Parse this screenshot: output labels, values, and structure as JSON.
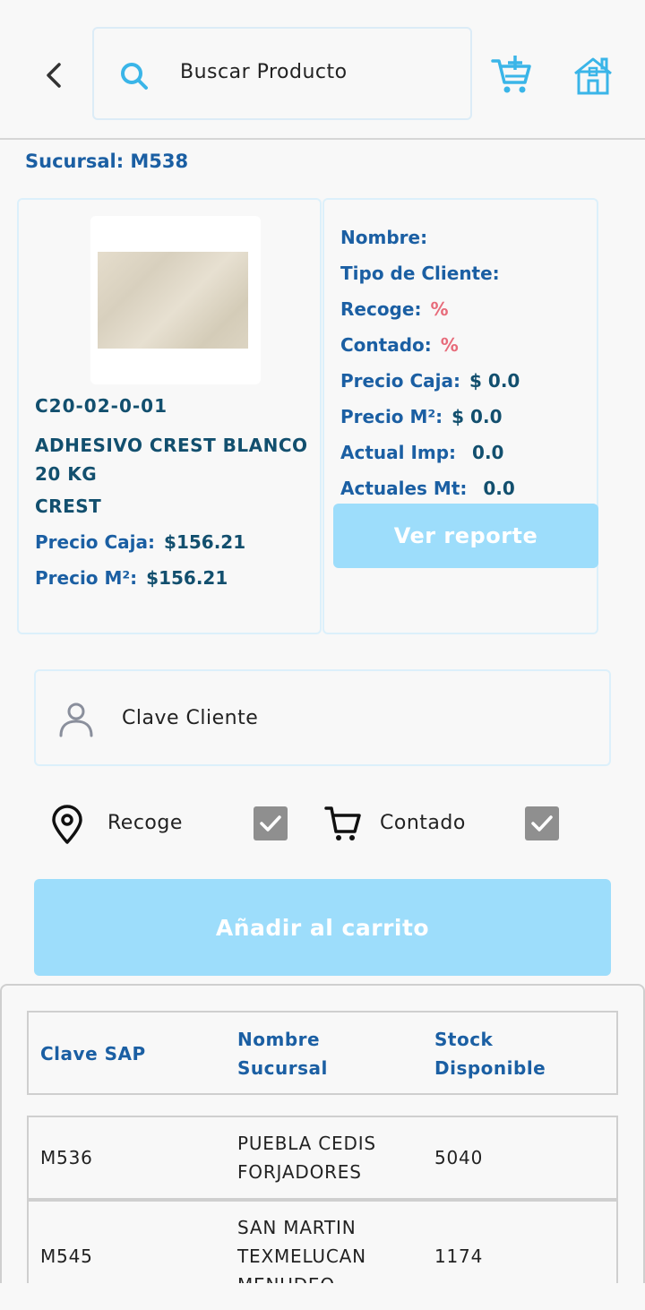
{
  "header": {
    "search_placeholder": "Buscar Producto"
  },
  "branch": "Sucursal: M538",
  "product": {
    "code": "C20-02-0-01",
    "name": "ADHESIVO CREST BLANCO 20 KG",
    "brand": "CREST",
    "price_box_label": "Precio Caja:",
    "price_box_value": "$156.21",
    "price_m2_label": "Precio M²:",
    "price_m2_value": "$156.21"
  },
  "info": {
    "name_label": "Nombre:",
    "client_type_label": "Tipo de Cliente:",
    "recoge_label": "Recoge:",
    "recoge_value": "%",
    "contado_label": "Contado:",
    "contado_value": "%",
    "price_box_label": "Precio Caja:",
    "price_box_value": "$ 0.0",
    "price_m2_label": "Precio M²:",
    "price_m2_value": "$ 0.0",
    "actual_imp_label": "Actual Imp:",
    "actual_imp_value": "0.0",
    "actual_mt_label": "Actuales Mt:",
    "actual_mt_value": "0.0",
    "report_button": "Ver reporte"
  },
  "client": {
    "placeholder": "Clave Cliente"
  },
  "options": {
    "recoge_label": "Recoge",
    "recoge_checked": true,
    "contado_label": "Contado",
    "contado_checked": true
  },
  "add_to_cart": "Añadir al carrito",
  "stock_table": {
    "headers": [
      "Clave SAP",
      "Nombre Sucursal",
      "Stock Disponible"
    ],
    "rows": [
      {
        "clave": "M536",
        "nombre": "PUEBLA CEDIS FORJADORES",
        "stock": "5040"
      },
      {
        "clave": "M545",
        "nombre": "SAN MARTIN TEXMELUCAN MENUDEO",
        "stock": "1174"
      }
    ]
  },
  "colors": {
    "accent": "#3ab5e8",
    "label_blue": "#1b5fa3",
    "value_dark": "#124f6e",
    "percent_red": "#e76b7a",
    "button_disabled": "#9dddfb"
  }
}
